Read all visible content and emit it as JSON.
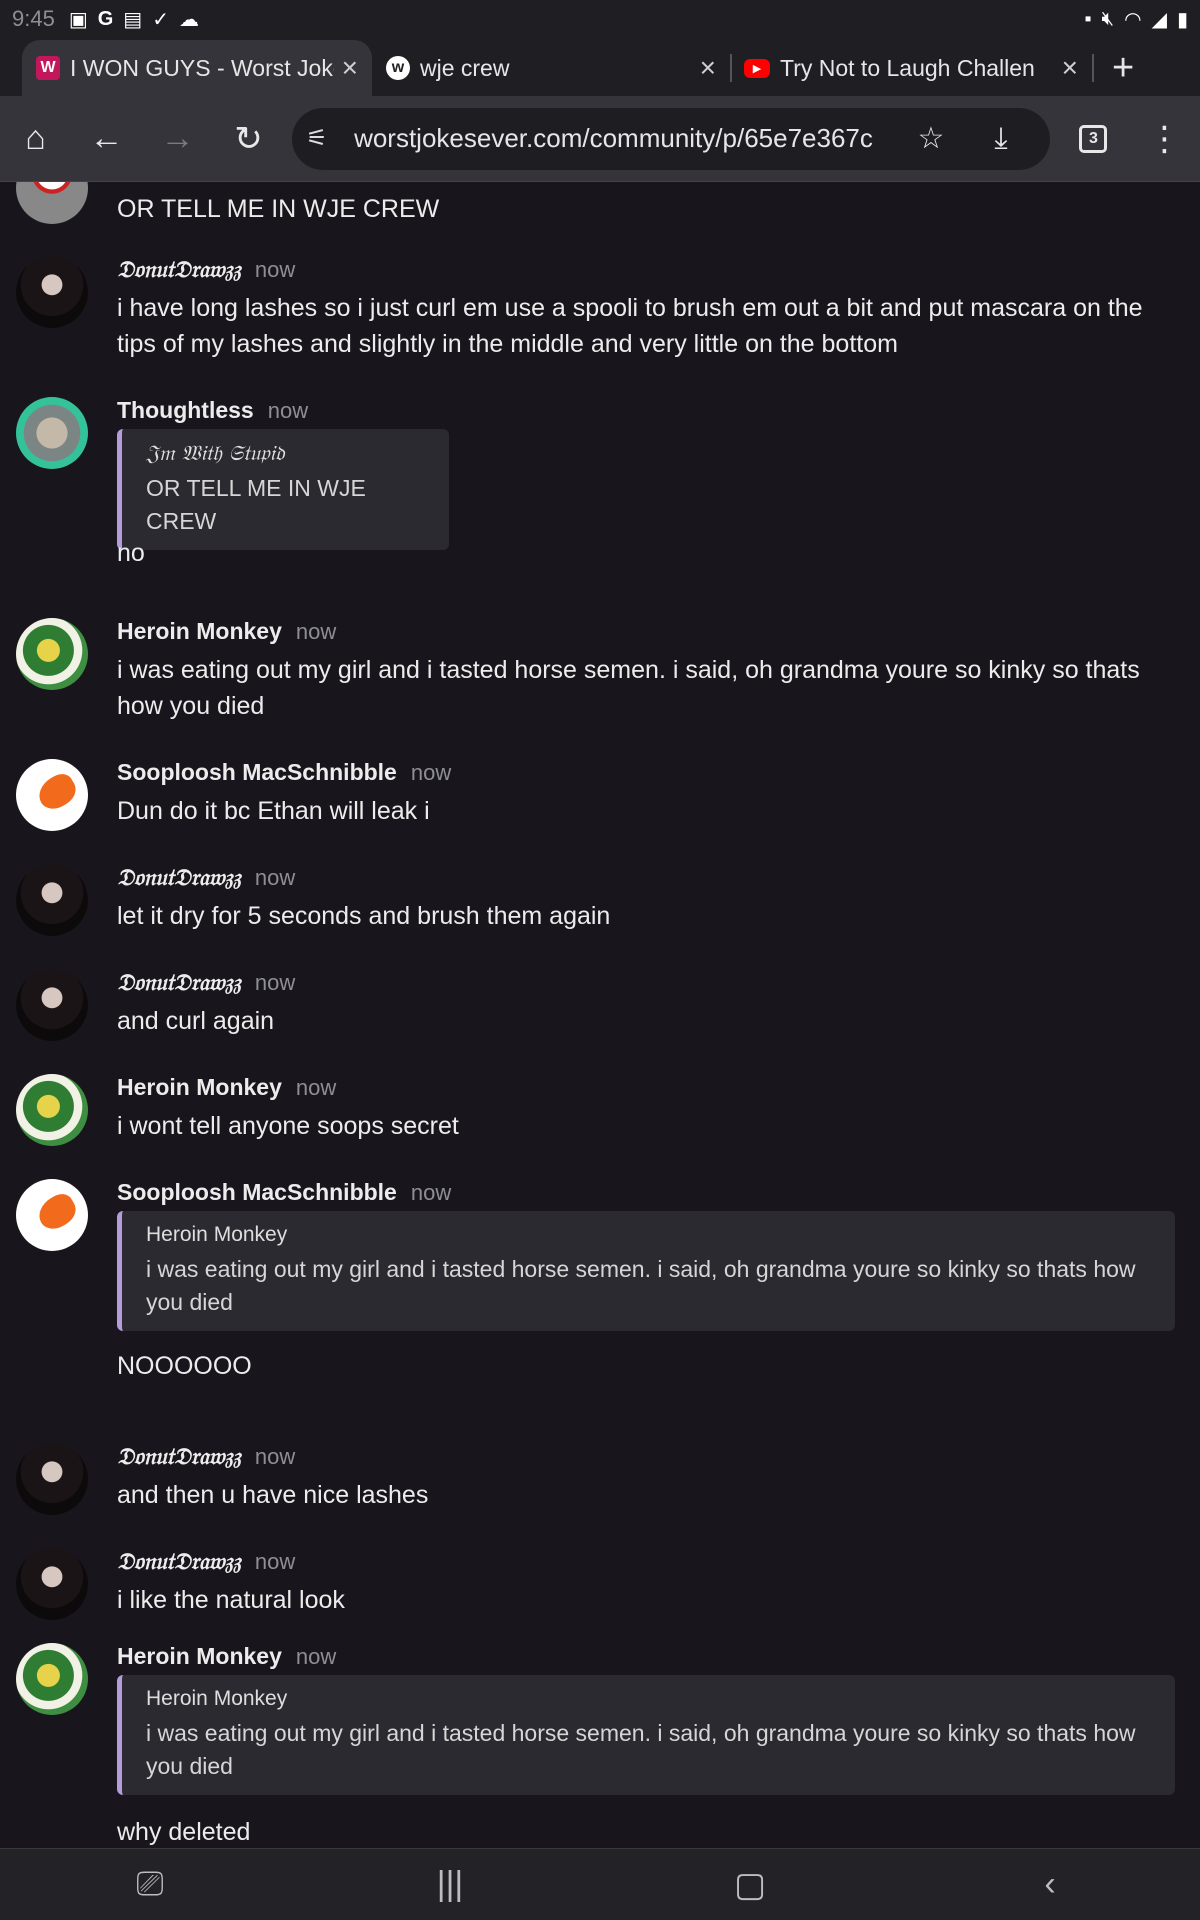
{
  "status": {
    "time": "9:45",
    "left_icons": [
      "image-icon",
      "google-icon",
      "app-icon",
      "check-icon",
      "cloud-icon"
    ],
    "right_icons": [
      "lock-icon",
      "mute-icon",
      "wifi-icon",
      "signal-icon",
      "battery-icon"
    ]
  },
  "tabs": [
    {
      "title": "I WON GUYS - Worst Joke",
      "favicon": "W"
    },
    {
      "title": "wje crew",
      "favicon": "w"
    },
    {
      "title": "Try Not to Laugh Challen",
      "favicon": "▶"
    }
  ],
  "toolbar": {
    "url": "worstjokesever.com/community/p/65e7e367c",
    "tab_count": "3"
  },
  "messages": [
    {
      "author": "",
      "time": "",
      "text": "OR TELL ME IN WJE CREW"
    },
    {
      "author": "𝔇𝔬𝔫𝔲𝔱𝔇𝔯𝔞𝔴𝔷𝔷",
      "time": "now",
      "text": "i have long lashes so i just curl em use a spooli to brush em out a bit and put mascara on the tips of my lashes and slightly in the middle and very little on the bottom"
    },
    {
      "author": "Thoughtless",
      "time": "now",
      "quote_author": "𝔍𝔪 𝔚𝔦𝔱𝔥 𝔖𝔱𝔲𝔭𝔦𝔡",
      "quote_text": "OR TELL ME IN WJE CREW",
      "text": "no"
    },
    {
      "author": "Heroin Monkey",
      "time": "now",
      "text": "i was eating out my girl and i tasted horse semen. i said, oh grandma youre so kinky so thats how you died"
    },
    {
      "author": "Sooploosh MacSchnibble",
      "time": "now",
      "text": "Dun do it bc Ethan will leak i"
    },
    {
      "author": "𝔇𝔬𝔫𝔲𝔱𝔇𝔯𝔞𝔴𝔷𝔷",
      "time": "now",
      "text": "let it dry for 5 seconds and brush them again"
    },
    {
      "author": "𝔇𝔬𝔫𝔲𝔱𝔇𝔯𝔞𝔴𝔷𝔷",
      "time": "now",
      "text": "and curl again"
    },
    {
      "author": "Heroin Monkey",
      "time": "now",
      "text": "i wont tell anyone soops secret"
    },
    {
      "author": "Sooploosh MacSchnibble",
      "time": "now",
      "quote_author": "Heroin Monkey",
      "quote_text": "i was eating out my girl and i tasted horse semen. i said, oh grandma youre so kinky so thats how you died",
      "text": "NOOOOOO"
    },
    {
      "author": "𝔇𝔬𝔫𝔲𝔱𝔇𝔯𝔞𝔴𝔷𝔷",
      "time": "now",
      "text": "and then u have nice lashes"
    },
    {
      "author": "𝔇𝔬𝔫𝔲𝔱𝔇𝔯𝔞𝔴𝔷𝔷",
      "time": "now",
      "text": "i like the natural look"
    },
    {
      "author": "Heroin Monkey",
      "time": "now",
      "quote_author": "Heroin Monkey",
      "quote_text": "i was eating out my girl and i tasted horse semen. i said, oh grandma youre so kinky so thats how you died",
      "text": "why deleted"
    }
  ],
  "colors": {
    "background": "#18161c",
    "quote_accent": "#b39ddb",
    "toolbar": "#35343a"
  }
}
